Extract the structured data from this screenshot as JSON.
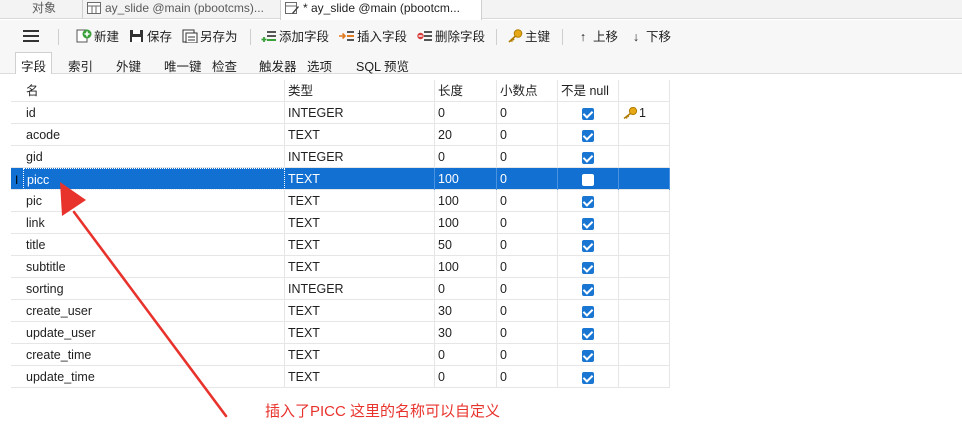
{
  "tabs": [
    {
      "label": "对象"
    },
    {
      "label": "ay_slide @main (pbootcms)..."
    },
    {
      "label": "* ay_slide @main (pbootcm..."
    }
  ],
  "toolbar": {
    "new_label": "新建",
    "save_label": "保存",
    "save_as_label": "另存为",
    "add_field_label": "添加字段",
    "insert_field_label": "插入字段",
    "delete_field_label": "删除字段",
    "primary_key_label": "主键",
    "move_up_label": "上移",
    "move_down_label": "下移"
  },
  "subtabs": [
    "字段",
    "索引",
    "外键",
    "唯一键",
    "检查",
    "触发器",
    "选项",
    "SQL 预览"
  ],
  "columns": [
    "名",
    "类型",
    "长度",
    "小数点",
    "不是 null",
    ""
  ],
  "rows": [
    {
      "name": "id",
      "type": "INTEGER",
      "length": "0",
      "decimals": "0",
      "not_null": true,
      "key": "1"
    },
    {
      "name": "acode",
      "type": "TEXT",
      "length": "20",
      "decimals": "0",
      "not_null": true,
      "key": ""
    },
    {
      "name": "gid",
      "type": "INTEGER",
      "length": "0",
      "decimals": "0",
      "not_null": true,
      "key": ""
    },
    {
      "name": "picc",
      "type": "TEXT",
      "length": "100",
      "decimals": "0",
      "not_null": false,
      "key": "",
      "selected": true
    },
    {
      "name": "pic",
      "type": "TEXT",
      "length": "100",
      "decimals": "0",
      "not_null": true,
      "key": ""
    },
    {
      "name": "link",
      "type": "TEXT",
      "length": "100",
      "decimals": "0",
      "not_null": true,
      "key": ""
    },
    {
      "name": "title",
      "type": "TEXT",
      "length": "50",
      "decimals": "0",
      "not_null": true,
      "key": ""
    },
    {
      "name": "subtitle",
      "type": "TEXT",
      "length": "100",
      "decimals": "0",
      "not_null": true,
      "key": ""
    },
    {
      "name": "sorting",
      "type": "INTEGER",
      "length": "0",
      "decimals": "0",
      "not_null": true,
      "key": ""
    },
    {
      "name": "create_user",
      "type": "TEXT",
      "length": "30",
      "decimals": "0",
      "not_null": true,
      "key": ""
    },
    {
      "name": "update_user",
      "type": "TEXT",
      "length": "30",
      "decimals": "0",
      "not_null": true,
      "key": ""
    },
    {
      "name": "create_time",
      "type": "TEXT",
      "length": "0",
      "decimals": "0",
      "not_null": true,
      "key": ""
    },
    {
      "name": "update_time",
      "type": "TEXT",
      "length": "0",
      "decimals": "0",
      "not_null": true,
      "key": ""
    }
  ],
  "annotation": "插入了PICC  这里的名称可以自定义",
  "colors": {
    "selection": "#1270d3",
    "checkbox": "#1976d2",
    "annotation": "#e8332d",
    "key": "#e6a817"
  }
}
